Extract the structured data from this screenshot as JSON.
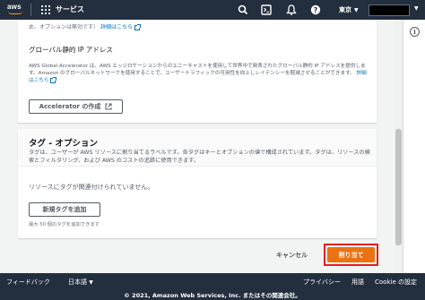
{
  "nav": {
    "logo": "aws",
    "services": "サービス",
    "region": "東京",
    "region_caret": "▼",
    "account_caret": "▼"
  },
  "panel1": {
    "top_line_prefix": "め、オプションは無効です）",
    "top_line_link": "詳細はこちら",
    "heading": "グローバル静的 IP アドレス",
    "description": "AWS Global Accelerator は、AWS エッジロケーションからのエニーキャストを使用して世界中で発表されたグローバル静的 IP アドレスを提供します。Amazon のグローバルネットワークを使用することで、ユーザートラフィックの可用性を向上しレイテンシーを軽減させることができます。",
    "description_link": "詳細はこちら",
    "accelerator_button": "Accelerator の作成"
  },
  "panel2": {
    "title": "タグ - オプション",
    "description": "タグは、ユーザーが AWS リソースに割り当てるラベルです。各タグはキーとオプションの値で構成されています。タグは、リソースの検索とフィルタリング、および AWS のコストの追跡に使用できます。",
    "empty_text": "リソースにタグが関連付けられていません。",
    "add_tag_button": "新規タグを追加",
    "limit_text": "最大 50 個のタグを追加できます"
  },
  "actions": {
    "cancel": "キャンセル",
    "assign": "割り当て"
  },
  "footer": {
    "feedback": "フィードバック",
    "language": "日本語",
    "language_caret": "▼",
    "privacy": "プライバシー",
    "terms": "用語",
    "cookie": "Cookie の設定",
    "copyright": "© 2021, Amazon Web Services, Inc. またはその関連会社。"
  },
  "colors": {
    "nav_bg": "#232f3e",
    "primary": "#ec7211",
    "link": "#0073bb",
    "highlight": "#e02020"
  }
}
